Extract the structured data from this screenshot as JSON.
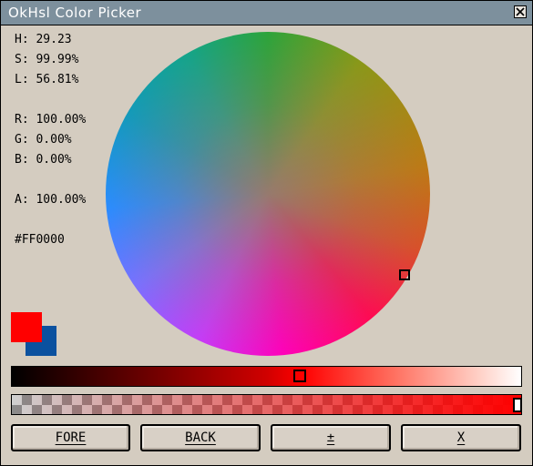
{
  "window": {
    "title": "OkHsl Color Picker"
  },
  "info": {
    "h": "H: 29.23",
    "s": "S: 99.99%",
    "l": "L: 56.81%",
    "r": "R: 100.00%",
    "g": "G: 0.00%",
    "b": "B: 0.00%",
    "a": "A: 100.00%",
    "hex": "#FF0000"
  },
  "colors": {
    "foreground": "#FF0000",
    "background": "#0B519F",
    "titlebar": "#7D909D",
    "panel": "#D4CCC0"
  },
  "sliders": {
    "lightness_level": 0.57,
    "alpha_level": 1.0
  },
  "buttons": {
    "fore": "FORE",
    "back": "BACK",
    "plusminus": "±",
    "x": "X"
  },
  "icons": {
    "close": "close-icon"
  }
}
